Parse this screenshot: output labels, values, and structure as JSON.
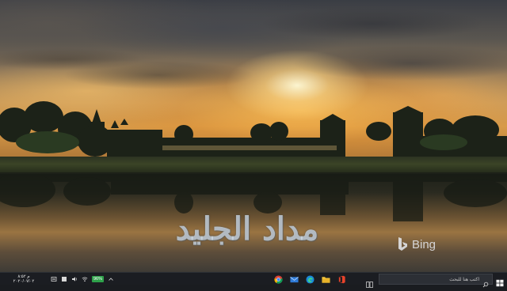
{
  "desktop": {
    "wallpaper_description_hidden": "",
    "watermark_text": "مداد الجليد",
    "bing_label": "Bing"
  },
  "taskbar": {
    "clock_time": "۸:۵۲ م",
    "clock_date": "۲۰۲۰/۰۷/۰۲",
    "battery_label": "96%",
    "search_placeholder": "اكتب هنا للبحث",
    "apps": [
      {
        "name": "chrome-icon"
      },
      {
        "name": "mail-icon"
      },
      {
        "name": "edge-icon"
      },
      {
        "name": "file-explorer-icon"
      },
      {
        "name": "office-icon"
      }
    ],
    "colors": {
      "background": "#1b1d22",
      "battery": "#2ea14a",
      "search_bg": "#2c2f35"
    }
  }
}
